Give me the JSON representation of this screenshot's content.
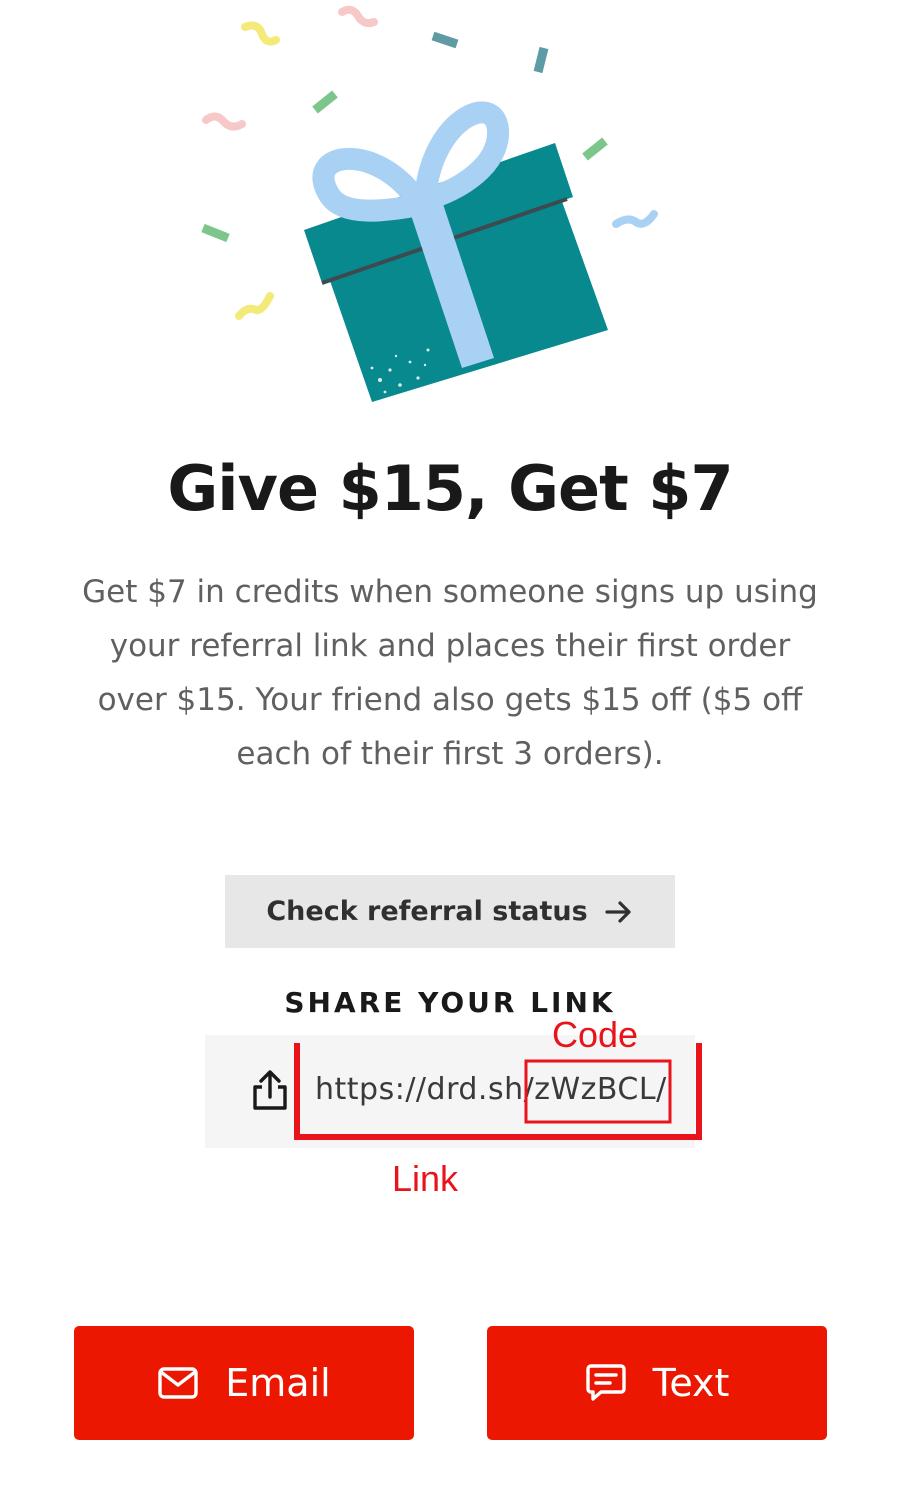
{
  "hero": {
    "icon": "gift-box-confetti-illustration"
  },
  "title": "Give $15, Get $7",
  "description": "Get $7 in credits when someone signs up using your referral link and places their first order over $15. Your friend also gets $15 off ($5 off each of their first 3 orders).",
  "status_button": {
    "label": "Check referral status",
    "icon": "arrow-right-icon"
  },
  "share": {
    "heading": "SHARE YOUR LINK",
    "link_prefix": "https://drd.sh/",
    "link_code": "zWzBCL",
    "link_suffix": "/",
    "icon": "share-icon"
  },
  "annotations": {
    "code_label": "Code",
    "link_label": "Link",
    "color": "#e8131b"
  },
  "buttons": {
    "email_label": "Email",
    "text_label": "Text",
    "email_icon": "mail-icon",
    "text_icon": "message-icon",
    "color": "#eb1700"
  },
  "colors": {
    "gift_box": "#08898e",
    "ribbon": "#a8d1f4"
  }
}
